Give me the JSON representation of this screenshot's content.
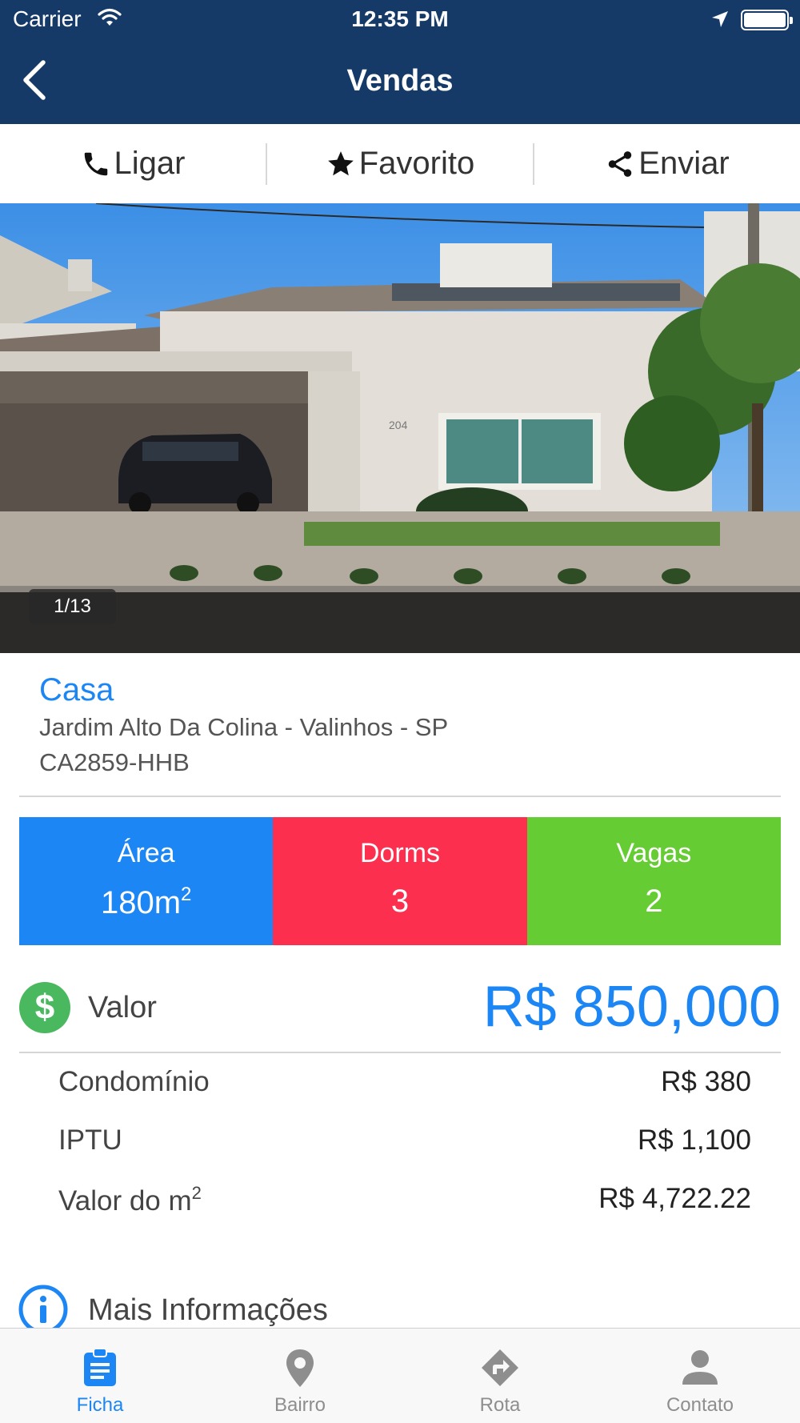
{
  "status_bar": {
    "carrier": "Carrier",
    "time": "12:35 PM"
  },
  "nav": {
    "title": "Vendas"
  },
  "actions": {
    "call_label": "Ligar",
    "favorite_label": "Favorito",
    "share_label": "Enviar"
  },
  "gallery": {
    "counter": "1/13"
  },
  "listing": {
    "type": "Casa",
    "address": "Jardim Alto Da Colina - Valinhos - SP",
    "code": "CA2859-HHB"
  },
  "stats": {
    "area_label": "Área",
    "area_value": "180m",
    "area_unit_exp": "2",
    "dorms_label": "Dorms",
    "dorms_value": "3",
    "vagas_label": "Vagas",
    "vagas_value": "2"
  },
  "price": {
    "icon_symbol": "$",
    "label": "Valor",
    "value": "R$ 850,000"
  },
  "costs": {
    "condominio_label": "Condomínio",
    "condominio_value": "R$ 380",
    "iptu_label": "IPTU",
    "iptu_value": "R$ 1,100",
    "m2_label": "Valor do m",
    "m2_exp": "2",
    "m2_value": "R$ 4,722.22"
  },
  "more_info": {
    "label": "Mais Informações"
  },
  "tabs": [
    {
      "label": "Ficha",
      "icon": "clipboard-icon",
      "active": true
    },
    {
      "label": "Bairro",
      "icon": "map-pin-icon",
      "active": false
    },
    {
      "label": "Rota",
      "icon": "directions-icon",
      "active": false
    },
    {
      "label": "Contato",
      "icon": "person-icon",
      "active": false
    }
  ],
  "colors": {
    "nav_bg": "#163a68",
    "accent_blue": "#1c86f5",
    "area_tile": "#1c86f5",
    "dorms_tile": "#fc2f4f",
    "vagas_tile": "#66cc33",
    "price_icon": "#49b85f"
  }
}
